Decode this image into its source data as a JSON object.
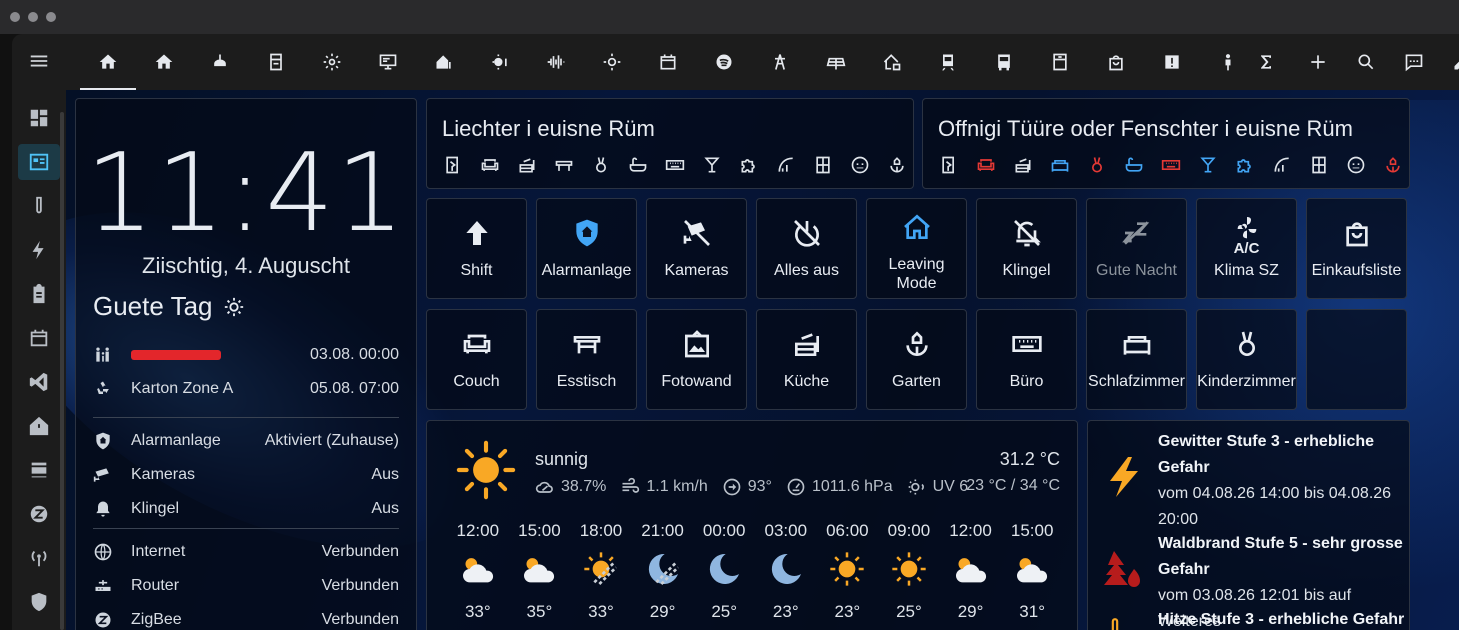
{
  "clock": {
    "time": "11:41",
    "date": "Ziischtig, 4. Auguscht",
    "greeting": "Guete Tag"
  },
  "info_rows": [
    {
      "icon": "family-icon",
      "label": "",
      "value": "03.08. 00:00",
      "redacted": true
    },
    {
      "icon": "recycle-icon",
      "label": "Karton Zone A",
      "value": "05.08. 07:00"
    },
    {
      "icon": "shield-icon",
      "label": "Alarmanlage",
      "value": "Aktiviert (Zuhause)"
    },
    {
      "icon": "cctv-icon",
      "label": "Kameras",
      "value": "Aus"
    },
    {
      "icon": "bell-icon",
      "label": "Klingel",
      "value": "Aus"
    },
    {
      "icon": "globe-icon",
      "label": "Internet",
      "value": "Verbunden"
    },
    {
      "icon": "router-icon",
      "label": "Router",
      "value": "Verbunden"
    },
    {
      "icon": "zigbee-icon",
      "label": "ZigBee",
      "value": "Verbunden"
    }
  ],
  "lights_card": {
    "title": "Liechter i euisne Rüm"
  },
  "openings_card": {
    "title": "Offnigi Tüüre oder Fenschter i euisne Rüm"
  },
  "colors": {
    "accent": "#4fc3f7",
    "red": "#e53935",
    "blue": "#42a5f5",
    "warning": "#f9a825"
  },
  "buttons_row1": [
    {
      "label": "Shift",
      "icon": "arrow-up-icon"
    },
    {
      "label": "Alarmanlage",
      "icon": "shield-home-icon"
    },
    {
      "label": "Kameras",
      "icon": "cctv-off-icon"
    },
    {
      "label": "Alles aus",
      "icon": "power-off-icon"
    },
    {
      "label": "Leaving Mode",
      "icon": "home-outline-icon"
    },
    {
      "label": "Klingel",
      "icon": "bell-off-icon"
    },
    {
      "label": "Gute Nacht",
      "icon": "sleep-off-icon"
    },
    {
      "label": "Klima SZ",
      "icon": "air-conditioner-icon"
    },
    {
      "label": "Einkaufsliste",
      "icon": "shopping-bag-icon"
    }
  ],
  "buttons_row2": [
    {
      "label": "Couch",
      "icon": "sofa-icon"
    },
    {
      "label": "Esstisch",
      "icon": "table-icon"
    },
    {
      "label": "Fotowand",
      "icon": "picture-icon"
    },
    {
      "label": "Küche",
      "icon": "stove-icon"
    },
    {
      "label": "Garten",
      "icon": "flower-icon"
    },
    {
      "label": "Büro",
      "icon": "keyboard-icon"
    },
    {
      "label": "Schlafzimmer",
      "icon": "bed-icon"
    },
    {
      "label": "Kinderzimmer",
      "icon": "rabbit-icon"
    }
  ],
  "weather": {
    "condition": "sunnig",
    "temperature": "31.2 °C",
    "range": "23 °C / 34 °C",
    "humidity": "38.7%",
    "wind": "1.1 km/h",
    "bearing": "93°",
    "pressure": "1011.6 hPa",
    "uv": "UV 6",
    "forecast": [
      {
        "time": "12:00",
        "icon": "partly-cloudy-icon",
        "temp": "33°"
      },
      {
        "time": "15:00",
        "icon": "partly-cloudy-icon",
        "temp": "35°"
      },
      {
        "time": "18:00",
        "icon": "sun-haze-icon",
        "temp": "33°"
      },
      {
        "time": "21:00",
        "icon": "moon-haze-icon",
        "temp": "29°"
      },
      {
        "time": "00:00",
        "icon": "moon-icon",
        "temp": "25°"
      },
      {
        "time": "03:00",
        "icon": "moon-icon",
        "temp": "23°"
      },
      {
        "time": "06:00",
        "icon": "sun-icon",
        "temp": "23°"
      },
      {
        "time": "09:00",
        "icon": "sun-icon",
        "temp": "25°"
      },
      {
        "time": "12:00",
        "icon": "partly-cloudy-icon",
        "temp": "29°"
      },
      {
        "time": "15:00",
        "icon": "partly-cloudy-icon",
        "temp": "31°"
      }
    ]
  },
  "warnings": [
    {
      "title": "Gewitter Stufe 3 - erhebliche Gefahr",
      "text": "vom 04.08.26 14:00 bis 04.08.26 20:00",
      "icon": "lightning-icon"
    },
    {
      "title": "Waldbrand Stufe 5 - sehr grosse Gefahr",
      "text": "vom 03.08.26 12:01 bis auf Weiteres",
      "icon": "forest-fire-icon"
    },
    {
      "title": "Hitze Stufe 3 - erhebliche Gefahr",
      "text": "",
      "icon": "thermometer-icon"
    }
  ]
}
